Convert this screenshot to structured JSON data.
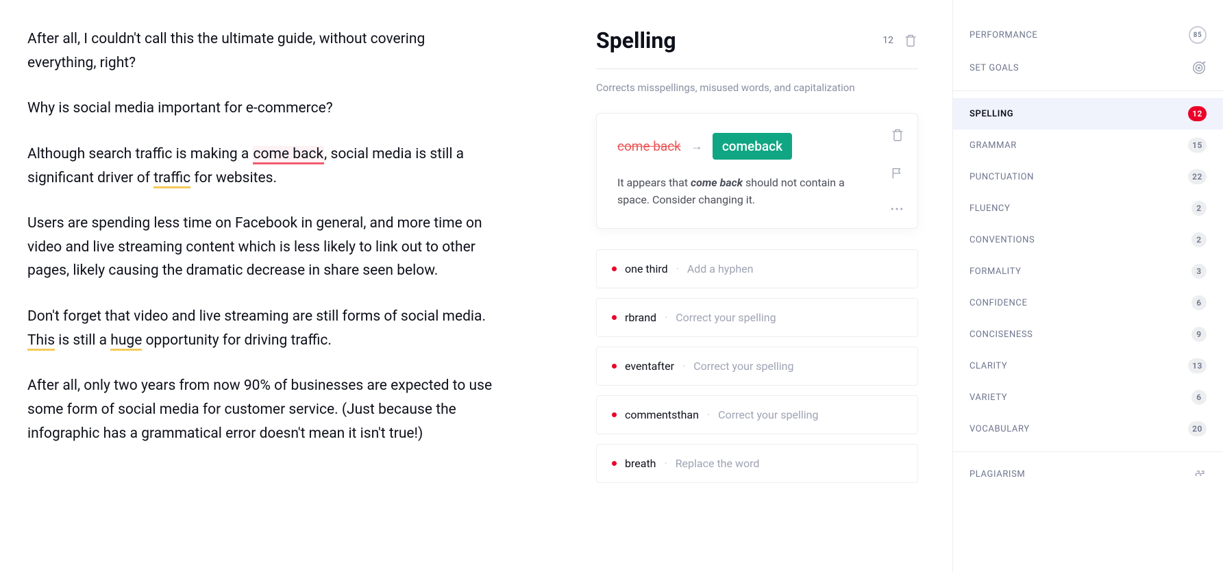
{
  "editor": {
    "p0a": "After all, I couldn't call this the ultimate guide, without covering everything, right?",
    "p1": "Why is social media important for e-commerce?",
    "p2a": "Although search traffic is making a ",
    "p2_err": "come back",
    "p2b": ", social media is still a significant driver of ",
    "p2_u1": "traffic",
    "p2c": " for websites.",
    "p3": "Users are spending less time on Facebook in general, and more time on video and live streaming content which is less likely to link out to other pages, likely causing the dramatic decrease in share seen below.",
    "p4a": "Don't forget that video and live streaming are still forms of social media. ",
    "p4_u1": "This",
    "p4b": " is still a ",
    "p4_u2": "huge",
    "p4c": " opportunity for driving traffic.",
    "p5": "After all, only two years from now 90% of businesses are expected to use some form of social media for customer service. (Just because the infographic has a grammatical error doesn't mean it isn't true!)"
  },
  "panel": {
    "title": "Spelling",
    "count": "12",
    "subtitle": "Corrects misspellings, misused words, and capitalization",
    "card": {
      "original": "come back",
      "suggestion": "comeback",
      "explain_a": "It appears that ",
      "explain_em": "come back",
      "explain_b": " should not contain a space. Consider changing it."
    },
    "rows": [
      {
        "key": "one third",
        "hint": "Add a hyphen"
      },
      {
        "key": "rbrand",
        "hint": "Correct your spelling"
      },
      {
        "key": "eventafter",
        "hint": "Correct your spelling"
      },
      {
        "key": "commentsthan",
        "hint": "Correct your spelling"
      },
      {
        "key": "breath",
        "hint": "Replace the word"
      }
    ]
  },
  "sidebar": {
    "performance": {
      "label": "Performance",
      "score": "85"
    },
    "goals": {
      "label": "Set Goals"
    },
    "cats": [
      {
        "label": "Spelling",
        "count": "12",
        "active": true
      },
      {
        "label": "Grammar",
        "count": "15"
      },
      {
        "label": "Punctuation",
        "count": "22"
      },
      {
        "label": "Fluency",
        "count": "2"
      },
      {
        "label": "Conventions",
        "count": "2"
      },
      {
        "label": "Formality",
        "count": "3"
      },
      {
        "label": "Confidence",
        "count": "6"
      },
      {
        "label": "Conciseness",
        "count": "9"
      },
      {
        "label": "Clarity",
        "count": "13"
      },
      {
        "label": "Variety",
        "count": "6"
      },
      {
        "label": "Vocabulary",
        "count": "20"
      }
    ],
    "plagiarism": {
      "label": "Plagiarism"
    }
  }
}
